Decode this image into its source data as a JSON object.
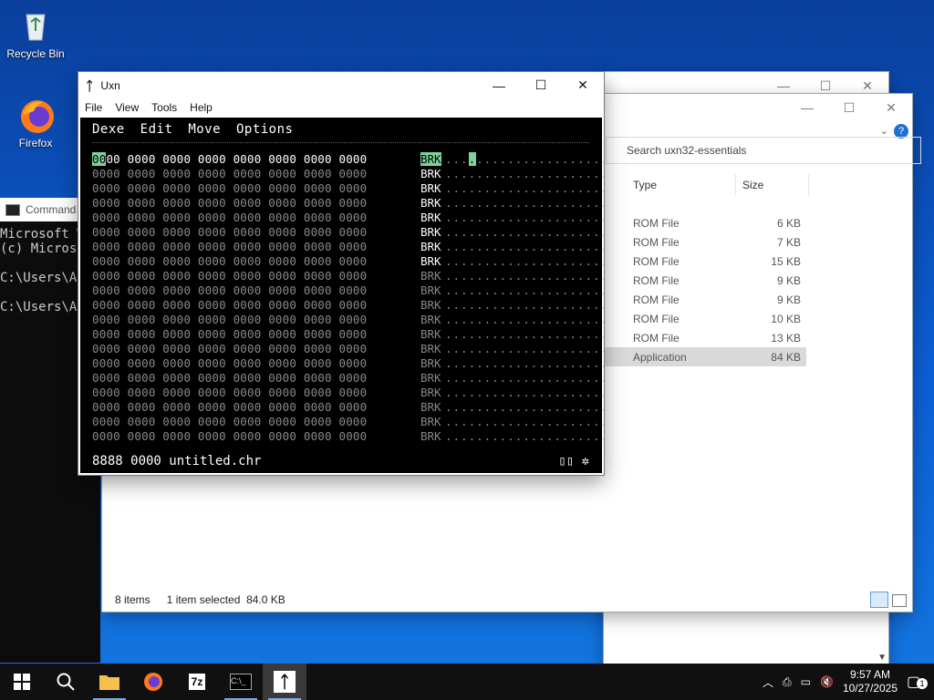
{
  "desktop": {
    "icons": [
      {
        "label": "Recycle Bin",
        "icon": "recycle-bin-icon"
      },
      {
        "label": "Firefox",
        "icon": "firefox-icon"
      }
    ]
  },
  "cmd": {
    "title": "Command",
    "lines": [
      "Microsoft W",
      "(c) Microso",
      "",
      "C:\\Users\\Ad",
      "",
      "C:\\Users\\Ad"
    ]
  },
  "explorer": {
    "search_placeholder": "Search uxn32-essentials",
    "columns": {
      "type": "Type",
      "size": "Size"
    },
    "rows": [
      {
        "type": "ROM File",
        "size": "6 KB"
      },
      {
        "type": "ROM File",
        "size": "7 KB"
      },
      {
        "type": "ROM File",
        "size": "15 KB"
      },
      {
        "type": "ROM File",
        "size": "9 KB"
      },
      {
        "type": "ROM File",
        "size": "9 KB"
      },
      {
        "type": "ROM File",
        "size": "10 KB"
      },
      {
        "type": "ROM File",
        "size": "13 KB"
      },
      {
        "type": "Application",
        "size": "84 KB"
      }
    ],
    "status": {
      "items": "8 items",
      "selected": "1 item selected",
      "size": "84.0 KB"
    }
  },
  "uxn": {
    "title": "Uxn",
    "menu": [
      "File",
      "View",
      "Tools",
      "Help"
    ],
    "screen_menu": [
      "Dexe",
      "Edit",
      "Move",
      "Options"
    ],
    "hex_word": "0000",
    "opcode": "BRK",
    "footer": "8888 0000 untitled.chr",
    "footer_icons": "▯▯ ✲"
  },
  "taskbar": {
    "clock_time": "9:57 AM",
    "clock_date": "10/27/2025",
    "notification_count": "1"
  }
}
